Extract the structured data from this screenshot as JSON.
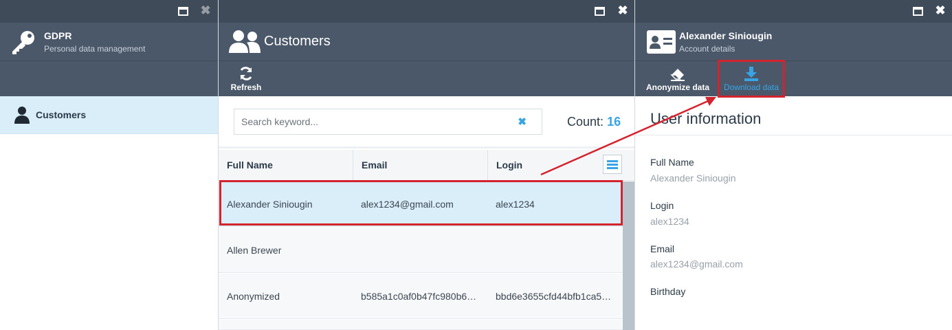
{
  "blade_gdpr": {
    "title": "GDPR",
    "subtitle": "Personal data management",
    "nav_items": [
      {
        "label": "Customers",
        "icon": "user-icon"
      }
    ]
  },
  "blade_customers": {
    "title": "Customers",
    "toolbar": {
      "refresh_label": "Refresh"
    },
    "search": {
      "placeholder": "Search keyword...",
      "value": ""
    },
    "count_label": "Count:",
    "count_value": "16",
    "columns": [
      "Full Name",
      "Email",
      "Login"
    ],
    "rows": [
      {
        "full_name": "Alexander Siniougin",
        "email": "alex1234@gmail.com",
        "login": "alex1234",
        "selected": true
      },
      {
        "full_name": "Allen Brewer",
        "email": "",
        "login": "",
        "selected": false
      },
      {
        "full_name": "Anonymized",
        "email": "b585a1c0af0b47fc980b6…",
        "login": "bbd6e3655cfd44bfb1ca5…",
        "selected": false
      }
    ]
  },
  "blade_account": {
    "title": "Alexander Siniougin",
    "subtitle": "Account details",
    "toolbar": {
      "anonymize_label": "Anonymize data",
      "download_label": "Download data"
    },
    "section_title": "User information",
    "fields": [
      {
        "label": "Full Name",
        "value": "Alexander Siniougin"
      },
      {
        "label": "Login",
        "value": "alex1234"
      },
      {
        "label": "Email",
        "value": "alex1234@gmail.com"
      },
      {
        "label": "Birthday",
        "value": ""
      }
    ]
  },
  "colors": {
    "topbar": "#3f4b58",
    "header": "#4b5869",
    "accent": "#38a4e5",
    "selected_row": "#d9eef9",
    "highlight": "#d5232e"
  }
}
